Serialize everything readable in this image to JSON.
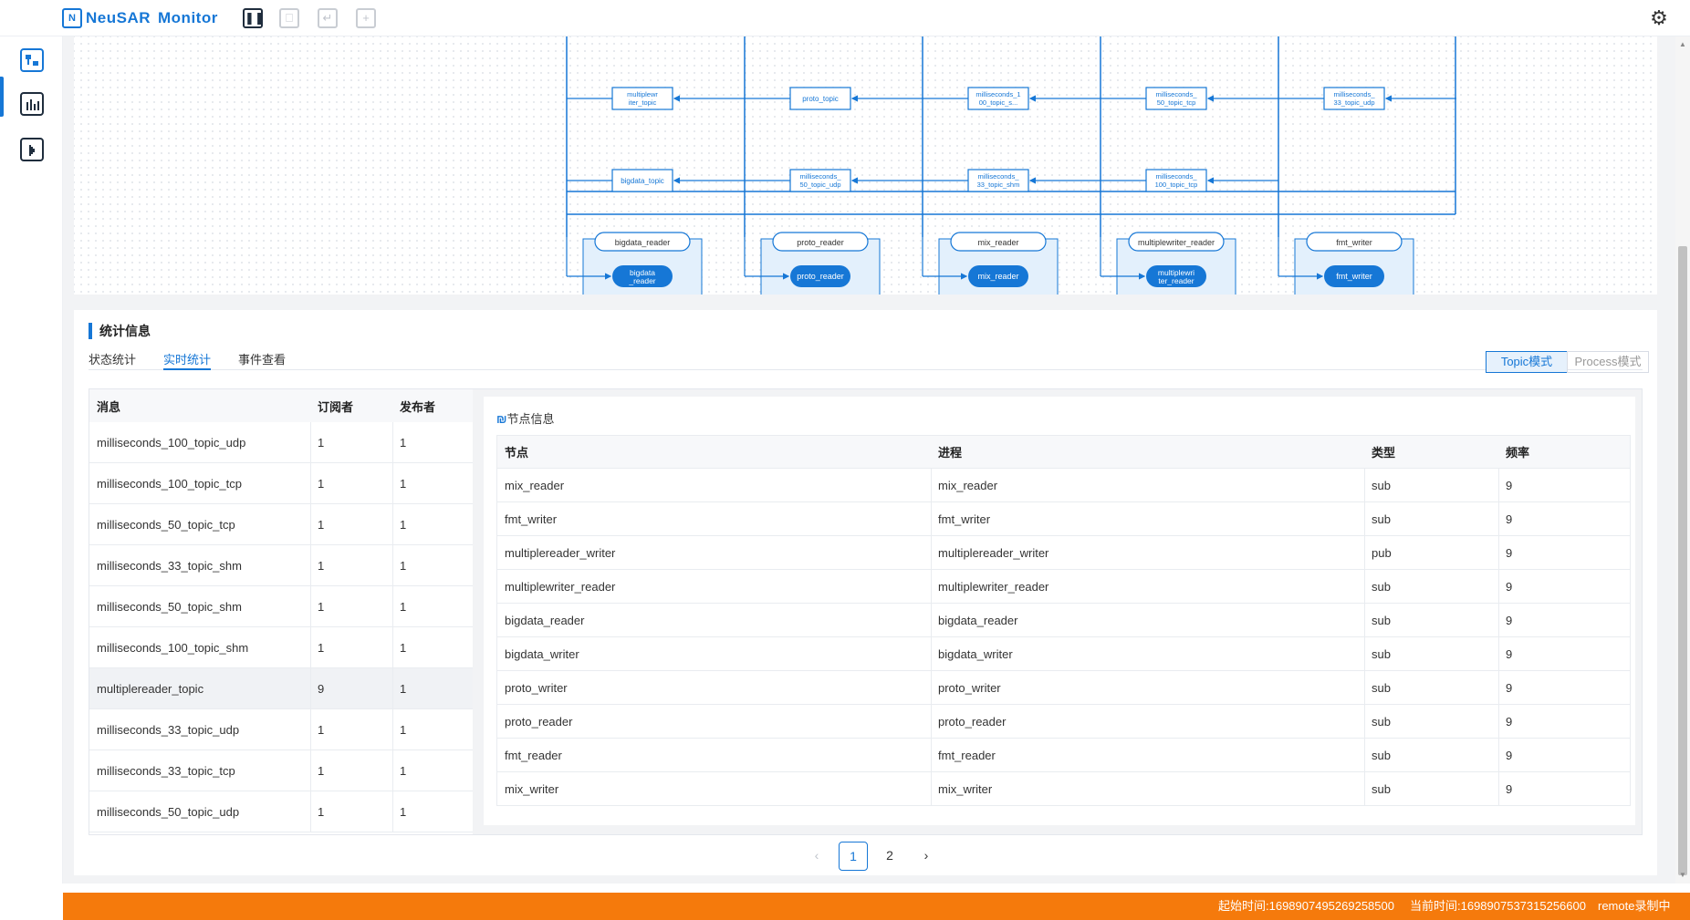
{
  "header": {
    "logo_icon": "N",
    "logo_a": "NeuSAR",
    "logo_b": "Monitor",
    "tools": [
      "pause-icon",
      "monitor-icon",
      "undo-icon",
      "add-icon"
    ],
    "settings_icon": "gear-icon"
  },
  "rail": {
    "items": [
      "topology-icon",
      "chart-icon",
      "playback-icon"
    ]
  },
  "graph": {
    "topics_row1": [
      "multiplewriter_topic",
      "proto_topic",
      "milliseconds_100_topic_s...",
      "milliseconds_50_topic_tcp",
      "milliseconds_33_topic_udp"
    ],
    "topics_row2": [
      "bigdata_topic",
      "milliseconds_50_topic_udp",
      "milliseconds_33_topic_shm",
      "milliseconds_100_topic_tcp"
    ],
    "processes": [
      "bigdata_reader",
      "proto_reader",
      "mix_reader",
      "multiplewriter_reader",
      "fmt_writer"
    ],
    "nodes": [
      "bigdata_reader",
      "proto_reader",
      "mix_reader",
      "multiplewriter_reader",
      "fmt_writer"
    ]
  },
  "stats": {
    "title": "统计信息",
    "tabs": [
      "状态统计",
      "实时统计",
      "事件查看"
    ],
    "active_tab": "实时统计",
    "modes": [
      "Topic模式",
      "Process模式"
    ],
    "active_mode": "Topic模式",
    "left_columns": [
      "消息",
      "订阅者",
      "发布者"
    ],
    "left_rows": [
      [
        "milliseconds_100_topic_udp",
        "1",
        "1"
      ],
      [
        "milliseconds_100_topic_tcp",
        "1",
        "1"
      ],
      [
        "milliseconds_50_topic_tcp",
        "1",
        "1"
      ],
      [
        "milliseconds_33_topic_shm",
        "1",
        "1"
      ],
      [
        "milliseconds_50_topic_shm",
        "1",
        "1"
      ],
      [
        "milliseconds_100_topic_shm",
        "1",
        "1"
      ],
      [
        "multiplereader_topic",
        "9",
        "1"
      ],
      [
        "milliseconds_33_topic_udp",
        "1",
        "1"
      ],
      [
        "milliseconds_33_topic_tcp",
        "1",
        "1"
      ],
      [
        "milliseconds_50_topic_udp",
        "1",
        "1"
      ]
    ],
    "selected_row": 6,
    "node_info_icon": "₪",
    "node_info_title": "节点信息",
    "right_columns": [
      "节点",
      "进程",
      "类型",
      "频率"
    ],
    "right_rows": [
      [
        "mix_reader",
        "mix_reader",
        "sub",
        "9"
      ],
      [
        "fmt_writer",
        "fmt_writer",
        "sub",
        "9"
      ],
      [
        "multiplereader_writer",
        "multiplereader_writer",
        "pub",
        "9"
      ],
      [
        "multiplewriter_reader",
        "multiplewriter_reader",
        "sub",
        "9"
      ],
      [
        "bigdata_reader",
        "bigdata_reader",
        "sub",
        "9"
      ],
      [
        "bigdata_writer",
        "bigdata_writer",
        "sub",
        "9"
      ],
      [
        "proto_writer",
        "proto_writer",
        "sub",
        "9"
      ],
      [
        "proto_reader",
        "proto_reader",
        "sub",
        "9"
      ],
      [
        "fmt_reader",
        "fmt_reader",
        "sub",
        "9"
      ],
      [
        "mix_writer",
        "mix_writer",
        "sub",
        "9"
      ]
    ],
    "pagination": {
      "prev": "‹",
      "pages": [
        "1",
        "2"
      ],
      "current": "1",
      "next": "›"
    }
  },
  "status": {
    "start": "起始时间:1698907495269258500",
    "current": "当前时间:1698907537315256600",
    "recording": "remote录制中"
  },
  "colors": {
    "accent": "#1677d6",
    "status_bar": "#f57a0c"
  }
}
